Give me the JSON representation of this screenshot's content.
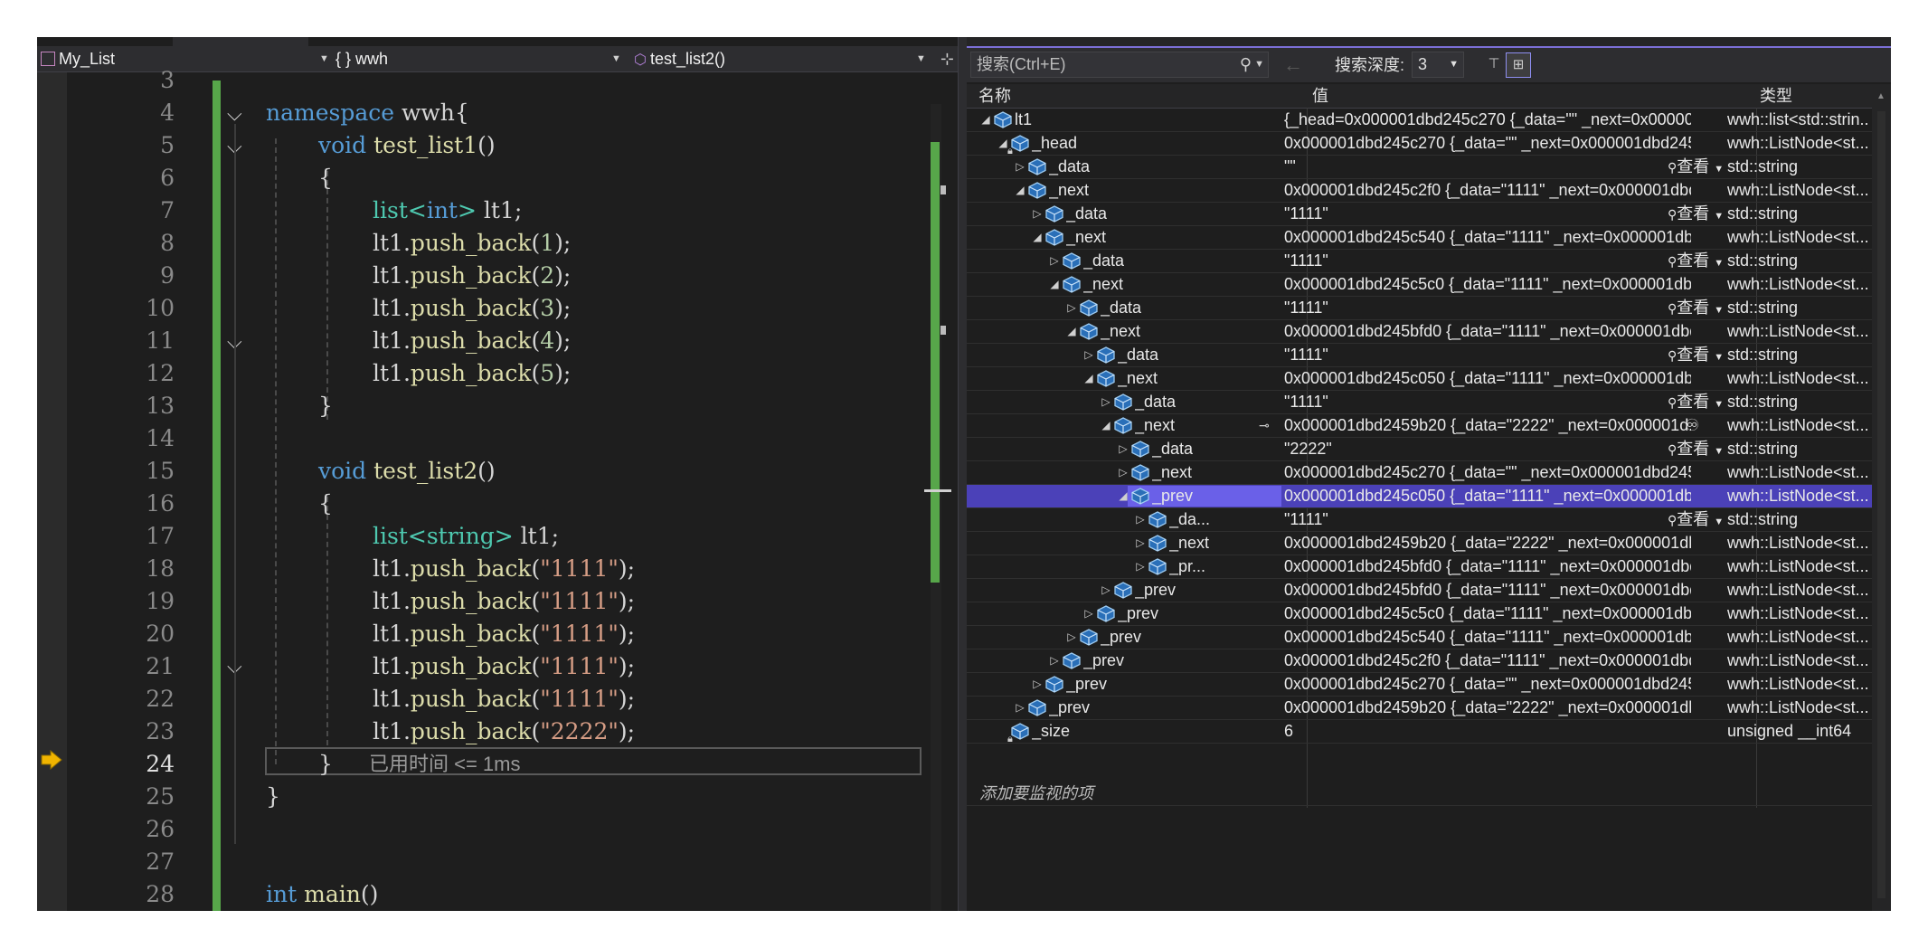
{
  "editor": {
    "nav": {
      "project": "My_List",
      "scope": "{ } wwh",
      "member": "test_list2()"
    },
    "current_line": 24,
    "perf_tip": "已用时间 <= 1ms",
    "line_numbers": [
      "3",
      "4",
      "5",
      "6",
      "7",
      "8",
      "9",
      "10",
      "11",
      "12",
      "13",
      "14",
      "15",
      "16",
      "17",
      "18",
      "19",
      "20",
      "21",
      "22",
      "23",
      "24",
      "25",
      "26",
      "27",
      "28"
    ],
    "code": {
      "l4": {
        "kw": "namespace",
        "rest": "wwh{"
      },
      "l5": {
        "kw": "void",
        "fn": "test_list1",
        "rest": "()"
      },
      "l6": {
        "text": "{"
      },
      "l7": {
        "ty": "list",
        "open": "<",
        "kw": "int",
        "close": ">",
        "rest": "lt1;"
      },
      "l8": {
        "obj": "lt1.",
        "fn": "push_back",
        "open": "(",
        "arg": "1",
        "close": ");"
      },
      "l9": {
        "obj": "lt1.",
        "fn": "push_back",
        "open": "(",
        "arg": "2",
        "close": ");"
      },
      "l10": {
        "obj": "lt1.",
        "fn": "push_back",
        "open": "(",
        "arg": "3",
        "close": ");"
      },
      "l11": {
        "obj": "lt1.",
        "fn": "push_back",
        "open": "(",
        "arg": "4",
        "close": ");"
      },
      "l12": {
        "obj": "lt1.",
        "fn": "push_back",
        "open": "(",
        "arg": "5",
        "close": ");"
      },
      "l13": {
        "text": "}"
      },
      "l15": {
        "kw": "void",
        "fn": "test_list2",
        "rest": "()"
      },
      "l16": {
        "text": "{"
      },
      "l17": {
        "ty": "list",
        "open": "<",
        "ty2": "string",
        "close": ">",
        "rest": "lt1;"
      },
      "l18": {
        "obj": "lt1.",
        "fn": "push_back",
        "open": "(",
        "arg": "\"1111\"",
        "close": ");"
      },
      "l19": {
        "obj": "lt1.",
        "fn": "push_back",
        "open": "(",
        "arg": "\"1111\"",
        "close": ");"
      },
      "l20": {
        "obj": "lt1.",
        "fn": "push_back",
        "open": "(",
        "arg": "\"1111\"",
        "close": ");"
      },
      "l21": {
        "obj": "lt1.",
        "fn": "push_back",
        "open": "(",
        "arg": "\"1111\"",
        "close": ");"
      },
      "l22": {
        "obj": "lt1.",
        "fn": "push_back",
        "open": "(",
        "arg": "\"1111\"",
        "close": ");"
      },
      "l23": {
        "obj": "lt1.",
        "fn": "push_back",
        "open": "(",
        "arg": "\"2222\"",
        "close": ");"
      },
      "l24": {
        "text": "}"
      },
      "l25": {
        "text": "}"
      },
      "l28": {
        "kw": "int",
        "fn": "main",
        "rest": "()"
      }
    }
  },
  "watch": {
    "search_placeholder": "搜索(Ctrl+E)",
    "depth_label": "搜索深度:",
    "depth_value": "3",
    "nav_arrows": "← →",
    "columns": {
      "name": "名称",
      "value": "值",
      "type": "类型"
    },
    "view_label": "查看",
    "add_item": "添加要监视的项",
    "rows": [
      {
        "name": "lt1",
        "value": "{_head=0x000001dbd245c270 {_data=\"\" _next=0x000001db...",
        "type": "wwh::list<std::strin..."
      },
      {
        "name": "_head",
        "value": "0x000001dbd245c270 {_data=\"\" _next=0x000001dbd245c2f...",
        "type": "wwh::ListNode<st..."
      },
      {
        "name": "_data",
        "value": "\"\"",
        "type": "std::string"
      },
      {
        "name": "_next",
        "value": "0x000001dbd245c2f0 {_data=\"1111\" _next=0x000001dbd2...",
        "type": "wwh::ListNode<st..."
      },
      {
        "name": "_data",
        "value": "\"1111\"",
        "type": "std::string"
      },
      {
        "name": "_next",
        "value": "0x000001dbd245c540 {_data=\"1111\" _next=0x000001dbd2...",
        "type": "wwh::ListNode<st..."
      },
      {
        "name": "_data",
        "value": "\"1111\"",
        "type": "std::string"
      },
      {
        "name": "_next",
        "value": "0x000001dbd245c5c0 {_data=\"1111\" _next=0x000001dbd2...",
        "type": "wwh::ListNode<st..."
      },
      {
        "name": "_data",
        "value": "\"1111\"",
        "type": "std::string"
      },
      {
        "name": "_next",
        "value": "0x000001dbd245bfd0 {_data=\"1111\" _next=0x000001dbd2...",
        "type": "wwh::ListNode<st..."
      },
      {
        "name": "_data",
        "value": "\"1111\"",
        "type": "std::string"
      },
      {
        "name": "_next",
        "value": "0x000001dbd245c050 {_data=\"1111\" _next=0x000001dbd2...",
        "type": "wwh::ListNode<st..."
      },
      {
        "name": "_data",
        "value": "\"1111\"",
        "type": "std::string"
      },
      {
        "name": "_next",
        "value": "0x000001dbd2459b20 {_data=\"2222\" _next=0x000001d...",
        "type": "wwh::ListNode<st..."
      },
      {
        "name": "_data",
        "value": "\"2222\"",
        "type": "std::string"
      },
      {
        "name": "_next",
        "value": "0x000001dbd245c270 {_data=\"\" _next=0x000001dbd245c2f...",
        "type": "wwh::ListNode<st..."
      },
      {
        "name": "_prev",
        "value": "0x000001dbd245c050 {_data=\"1111\" _next=0x000001dbd2...",
        "type": "wwh::ListNode<st..."
      },
      {
        "name": "_da...",
        "value": "\"1111\"",
        "type": "std::string"
      },
      {
        "name": "_next",
        "value": "0x000001dbd2459b20 {_data=\"2222\" _next=0x000001dbd2...",
        "type": "wwh::ListNode<st..."
      },
      {
        "name": "_pr...",
        "value": "0x000001dbd245bfd0 {_data=\"1111\" _next=0x000001dbd2...",
        "type": "wwh::ListNode<st..."
      },
      {
        "name": "_prev",
        "value": "0x000001dbd245bfd0 {_data=\"1111\" _next=0x000001dbd2...",
        "type": "wwh::ListNode<st..."
      },
      {
        "name": "_prev",
        "value": "0x000001dbd245c5c0 {_data=\"1111\" _next=0x000001dbd2...",
        "type": "wwh::ListNode<st..."
      },
      {
        "name": "_prev",
        "value": "0x000001dbd245c540 {_data=\"1111\" _next=0x000001dbd2...",
        "type": "wwh::ListNode<st..."
      },
      {
        "name": "_prev",
        "value": "0x000001dbd245c2f0 {_data=\"1111\" _next=0x000001dbd2...",
        "type": "wwh::ListNode<st..."
      },
      {
        "name": "_prev",
        "value": "0x000001dbd245c270 {_data=\"\" _next=0x000001dbd245c2f...",
        "type": "wwh::ListNode<st..."
      },
      {
        "name": "_prev",
        "value": "0x000001dbd2459b20 {_data=\"2222\" _next=0x000001dbd2...",
        "type": "wwh::ListNode<st..."
      },
      {
        "name": "_size",
        "value": "6",
        "type": "unsigned __int64"
      }
    ]
  },
  "colors": {
    "keyword": "#569cd6",
    "function": "#dcdcaa",
    "type": "#4ec9b0",
    "number": "#b5cea8",
    "string": "#d69d85",
    "change_bar": "#57a64a",
    "selection": "#4b41b8",
    "breakpoint_arrow": "#f0b400"
  }
}
